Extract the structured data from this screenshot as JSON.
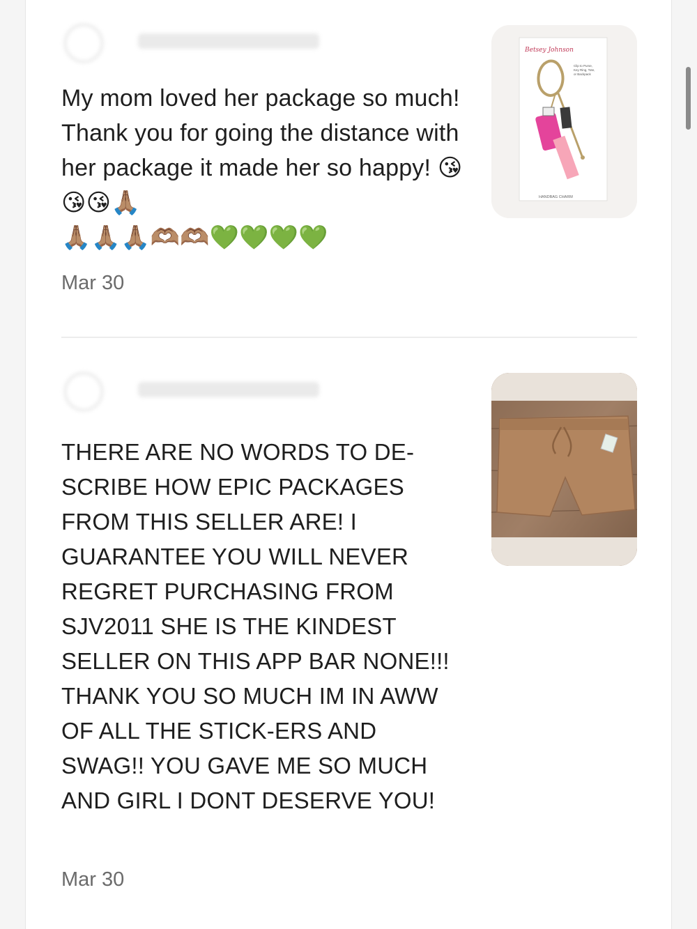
{
  "reviews": [
    {
      "username": "reviewer",
      "text": "My mom loved her package so much! Thank you for going the distance with her package it made her so happy!",
      "emoji_inline": "😘😘😘🙏🏽",
      "emoji_line": "🙏🏽🙏🏽🙏🏽🫶🏽🫶🏽💚💚💚💚",
      "date": "Mar 30",
      "thumbnail": {
        "brand": "Betsey Johnson",
        "caption": "HANDBAG CHARM",
        "note": "Clip to Purse, Key Ring, Tote, or Backpack"
      }
    },
    {
      "username": "reviewer",
      "text": "THERE ARE NO WORDS TO DE-SCRIBE HOW EPIC PACKAGES FROM THIS SELLER ARE! I GUARANTEE YOU WILL NEVER REGRET PURCHASING FROM SJV2011 SHE IS THE KINDEST SELLER ON THIS APP BAR NONE!!! THANK YOU SO MUCH IM IN AWW OF ALL THE STICK-ERS AND SWAG!! YOU GAVE ME SO MUCH AND GIRL I DONT DESERVE YOU!",
      "date": "Mar 30"
    }
  ],
  "colors": {
    "background": "#ffffff",
    "text": "#1e1e1e",
    "date": "#6b6b6b",
    "divider": "#ececec"
  }
}
